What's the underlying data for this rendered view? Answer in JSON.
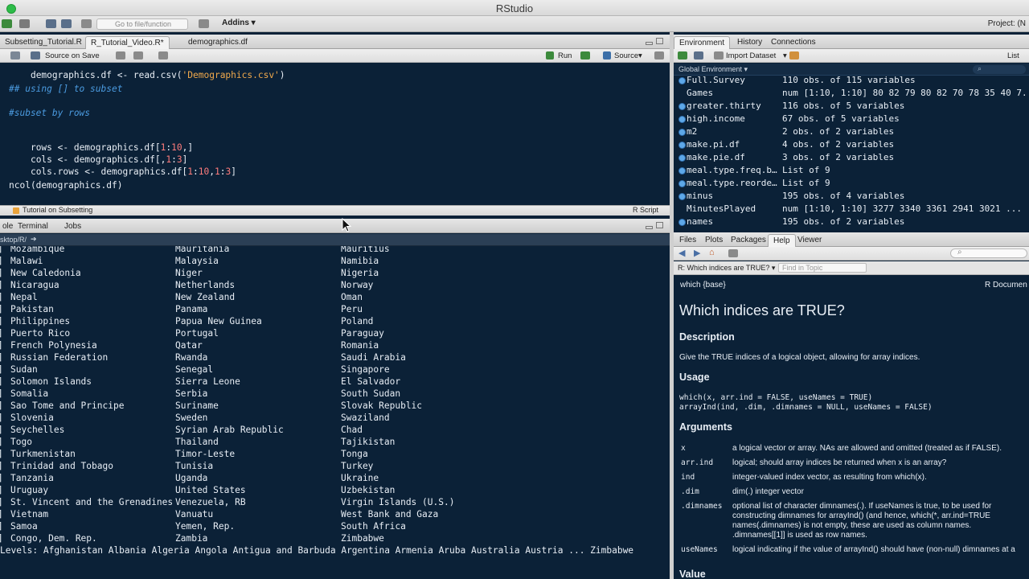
{
  "window": {
    "title": "RStudio",
    "project": "Project: (N"
  },
  "toolbar": {
    "goto_placeholder": "Go to file/function",
    "addins": "Addins"
  },
  "editor": {
    "tabs": [
      "Subsetting_Tutorial.R",
      "R_Tutorial_Video.R*",
      "demographics.df"
    ],
    "source_on_save": "Source on Save",
    "run": "Run",
    "source": "Source",
    "lines": [
      [
        {
          "t": "demographics.df <- read.csv(",
          "c": "plain"
        },
        {
          "t": "'Demographics.csv'",
          "c": "str"
        },
        {
          "t": ")",
          "c": "plain"
        }
      ],
      [
        {
          "t": "## using [] to subset",
          "c": "com"
        }
      ],
      [
        {
          "t": "#subset by rows",
          "c": "com"
        }
      ],
      [
        {
          "t": "rows <- demographics.df[",
          "c": "plain"
        },
        {
          "t": "1",
          "c": "num"
        },
        {
          "t": ":",
          "c": "plain"
        },
        {
          "t": "10",
          "c": "num"
        },
        {
          "t": ",]",
          "c": "plain"
        }
      ],
      [
        {
          "t": "cols <- demographics.df[,",
          "c": "plain"
        },
        {
          "t": "1",
          "c": "num"
        },
        {
          "t": ":",
          "c": "plain"
        },
        {
          "t": "3",
          "c": "num"
        },
        {
          "t": "]",
          "c": "plain"
        }
      ],
      [
        {
          "t": "cols.rows <- demographics.df[",
          "c": "plain"
        },
        {
          "t": "1",
          "c": "num"
        },
        {
          "t": ":",
          "c": "plain"
        },
        {
          "t": "10",
          "c": "num"
        },
        {
          "t": ",",
          "c": "plain"
        },
        {
          "t": "1",
          "c": "num"
        },
        {
          "t": ":",
          "c": "plain"
        },
        {
          "t": "3",
          "c": "num"
        },
        {
          "t": "]",
          "c": "plain"
        }
      ],
      [
        {
          "t": "ncol(demographics.df)",
          "c": "plain"
        }
      ]
    ],
    "status_left": "Tutorial on Subsetting",
    "status_right": "R Script"
  },
  "console": {
    "tabs": [
      "ole",
      "Terminal",
      "Jobs"
    ],
    "path": "sktop/R/",
    "rows": [
      [
        "Mozambique",
        "Mauritania",
        "Mauritius"
      ],
      [
        "Malawi",
        "Malaysia",
        "Namibia"
      ],
      [
        "New Caledonia",
        "Niger",
        "Nigeria"
      ],
      [
        "Nicaragua",
        "Netherlands",
        "Norway"
      ],
      [
        "Nepal",
        "New Zealand",
        "Oman"
      ],
      [
        "Pakistan",
        "Panama",
        "Peru"
      ],
      [
        "Philippines",
        "Papua New Guinea",
        "Poland"
      ],
      [
        "Puerto Rico",
        "Portugal",
        "Paraguay"
      ],
      [
        "French Polynesia",
        "Qatar",
        "Romania"
      ],
      [
        "Russian Federation",
        "Rwanda",
        "Saudi Arabia"
      ],
      [
        "Sudan",
        "Senegal",
        "Singapore"
      ],
      [
        "Solomon Islands",
        "Sierra Leone",
        "El Salvador"
      ],
      [
        "Somalia",
        "Serbia",
        "South Sudan"
      ],
      [
        "Sao Tome and Principe",
        "Suriname",
        "Slovak Republic"
      ],
      [
        "Slovenia",
        "Sweden",
        "Swaziland"
      ],
      [
        "Seychelles",
        "Syrian Arab Republic",
        "Chad"
      ],
      [
        "Togo",
        "Thailand",
        "Tajikistan"
      ],
      [
        "Turkmenistan",
        "Timor-Leste",
        "Tonga"
      ],
      [
        "Trinidad and Tobago",
        "Tunisia",
        "Turkey"
      ],
      [
        "Tanzania",
        "Uganda",
        "Ukraine"
      ],
      [
        "Uruguay",
        "United States",
        "Uzbekistan"
      ],
      [
        "St. Vincent and the Grenadines",
        "Venezuela, RB",
        "Virgin Islands (U.S.)"
      ],
      [
        "Vietnam",
        "Vanuatu",
        "West Bank and Gaza"
      ],
      [
        "Samoa",
        "Yemen, Rep.",
        "South Africa"
      ],
      [
        "Congo, Dem. Rep.",
        "Zambia",
        "Zimbabwe"
      ]
    ],
    "levels": "Levels: Afghanistan Albania Algeria Angola Antigua and Barbuda Argentina Armenia Aruba Australia Austria ... Zimbabwe"
  },
  "environment": {
    "tabs": [
      "Environment",
      "History",
      "Connections"
    ],
    "import_dataset": "Import Dataset",
    "list_view": "List",
    "scope": "Global Environment",
    "rows": [
      {
        "name": "Full.Survey",
        "value": "110 obs. of 115 variables",
        "dot": true
      },
      {
        "name": "Games",
        "value": "num [1:10, 1:10] 80 82 79 80 82 70 78 35 40 7...",
        "dot": false
      },
      {
        "name": "greater.thirty",
        "value": "116 obs. of 5 variables",
        "dot": true
      },
      {
        "name": "high.income",
        "value": "67 obs. of 5 variables",
        "dot": true
      },
      {
        "name": "m2",
        "value": "2 obs. of 2 variables",
        "dot": true
      },
      {
        "name": "make.pi.df",
        "value": "4 obs. of 2 variables",
        "dot": true
      },
      {
        "name": "make.pie.df",
        "value": "3 obs. of 2 variables",
        "dot": true
      },
      {
        "name": "meal.type.freq.b…",
        "value": "List of 9",
        "dot": true
      },
      {
        "name": "meal.type.reorde…",
        "value": "List of 9",
        "dot": true
      },
      {
        "name": "minus",
        "value": "195 obs. of 4 variables",
        "dot": true
      },
      {
        "name": "MinutesPlayed",
        "value": "num [1:10, 1:10] 3277 3340 3361 2941 3021 ...",
        "dot": false
      },
      {
        "name": "names",
        "value": "195 obs. of 2 variables",
        "dot": true
      }
    ]
  },
  "help": {
    "tabs": [
      "Files",
      "Plots",
      "Packages",
      "Help",
      "Viewer"
    ],
    "topic_select": "R: Which indices are TRUE?",
    "find_in_topic": "Find in Topic",
    "package": "which {base}",
    "doc_label": "R Documen",
    "title": "Which indices are TRUE?",
    "description_heading": "Description",
    "description": "Give the TRUE indices of a logical object, allowing for array indices.",
    "usage_heading": "Usage",
    "usage_1": "which(x, arr.ind = FALSE, useNames = TRUE)",
    "usage_2": "arrayInd(ind, .dim, .dimnames = NULL, useNames = FALSE)",
    "arguments_heading": "Arguments",
    "args": [
      {
        "name": "x",
        "desc": "a logical vector or array. NAs are allowed and omitted (treated as if FALSE)."
      },
      {
        "name": "arr.ind",
        "desc": "logical; should array indices be returned when x is an array?"
      },
      {
        "name": "ind",
        "desc": "integer-valued index vector, as resulting from which(x)."
      },
      {
        "name": ".dim",
        "desc": "dim(.) integer vector"
      },
      {
        "name": ".dimnames",
        "desc_lines": [
          "optional list of character dimnames(.). If useNames is true, to be used for",
          "constructing dimnames for arrayInd() (and hence, which(*, arr.ind=TRUE",
          "names(.dimnames) is not empty, these are used as column names.",
          ".dimnames[[1]] is used as row names."
        ]
      },
      {
        "name": "useNames",
        "desc": "logical indicating if the value of arrayInd() should have (non-null) dimnames at a"
      }
    ],
    "value_heading": "Value"
  },
  "colors": {
    "background": "#0b2137",
    "comment": "#4b9be0",
    "string": "#f0a94c",
    "number": "#ff7c7c",
    "text": "#e8eef5"
  }
}
